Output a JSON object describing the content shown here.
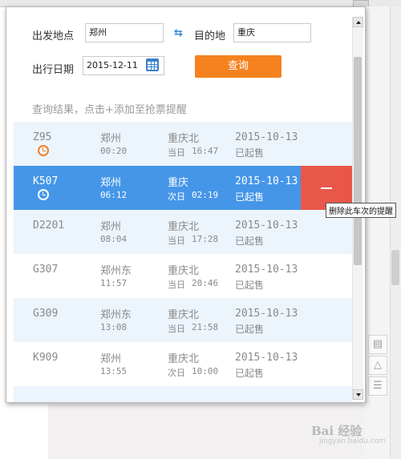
{
  "form": {
    "departure_label": "出发地点",
    "departure_value": "郑州",
    "destination_label": "目的地",
    "destination_value": "重庆",
    "date_label": "出行日期",
    "date_value": "2015-12-11",
    "query_button": "查询"
  },
  "results_hint": "查询结果，点击+添加至抢票提醒",
  "trains": [
    {
      "code": "Z95",
      "from": "郑州",
      "dep_time": "00:20",
      "to": "重庆北",
      "arr_day": "当日",
      "arr_time": "16:47",
      "date": "2015-10-13",
      "status": "已起售",
      "alarm": true
    },
    {
      "code": "K507",
      "from": "郑州",
      "dep_time": "06:12",
      "to": "重庆",
      "arr_day": "次日",
      "arr_time": "02:19",
      "date": "2015-10-13",
      "status": "已起售",
      "alarm": true,
      "selected": true
    },
    {
      "code": "D2201",
      "from": "郑州",
      "dep_time": "08:04",
      "to": "重庆北",
      "arr_day": "当日",
      "arr_time": "17:28",
      "date": "2015-10-13",
      "status": "已起售"
    },
    {
      "code": "G307",
      "from": "郑州东",
      "dep_time": "11:57",
      "to": "重庆北",
      "arr_day": "当日",
      "arr_time": "20:46",
      "date": "2015-10-13",
      "status": "已起售"
    },
    {
      "code": "G309",
      "from": "郑州东",
      "dep_time": "13:08",
      "to": "重庆北",
      "arr_day": "当日",
      "arr_time": "21:58",
      "date": "2015-10-13",
      "status": "已起售"
    },
    {
      "code": "K909",
      "from": "郑州",
      "dep_time": "13:55",
      "to": "重庆北",
      "arr_day": "次日",
      "arr_time": "10:00",
      "date": "2015-10-13",
      "status": "已起售"
    }
  ],
  "tooltip": "删除此车次的提醒",
  "watermark": "Bai 经验",
  "watermark_sub": "jingyan.baidu.com",
  "colors": {
    "accent_orange": "#f5821f",
    "selected_row": "#4596e8",
    "delete_red": "#e8574a",
    "alt_row": "#ecf4fc"
  },
  "icons": [
    "swap-icon",
    "calendar-icon",
    "alarm-clock-icon",
    "minus-icon",
    "chat-icon",
    "up-arrow-icon",
    "list-icon"
  ]
}
